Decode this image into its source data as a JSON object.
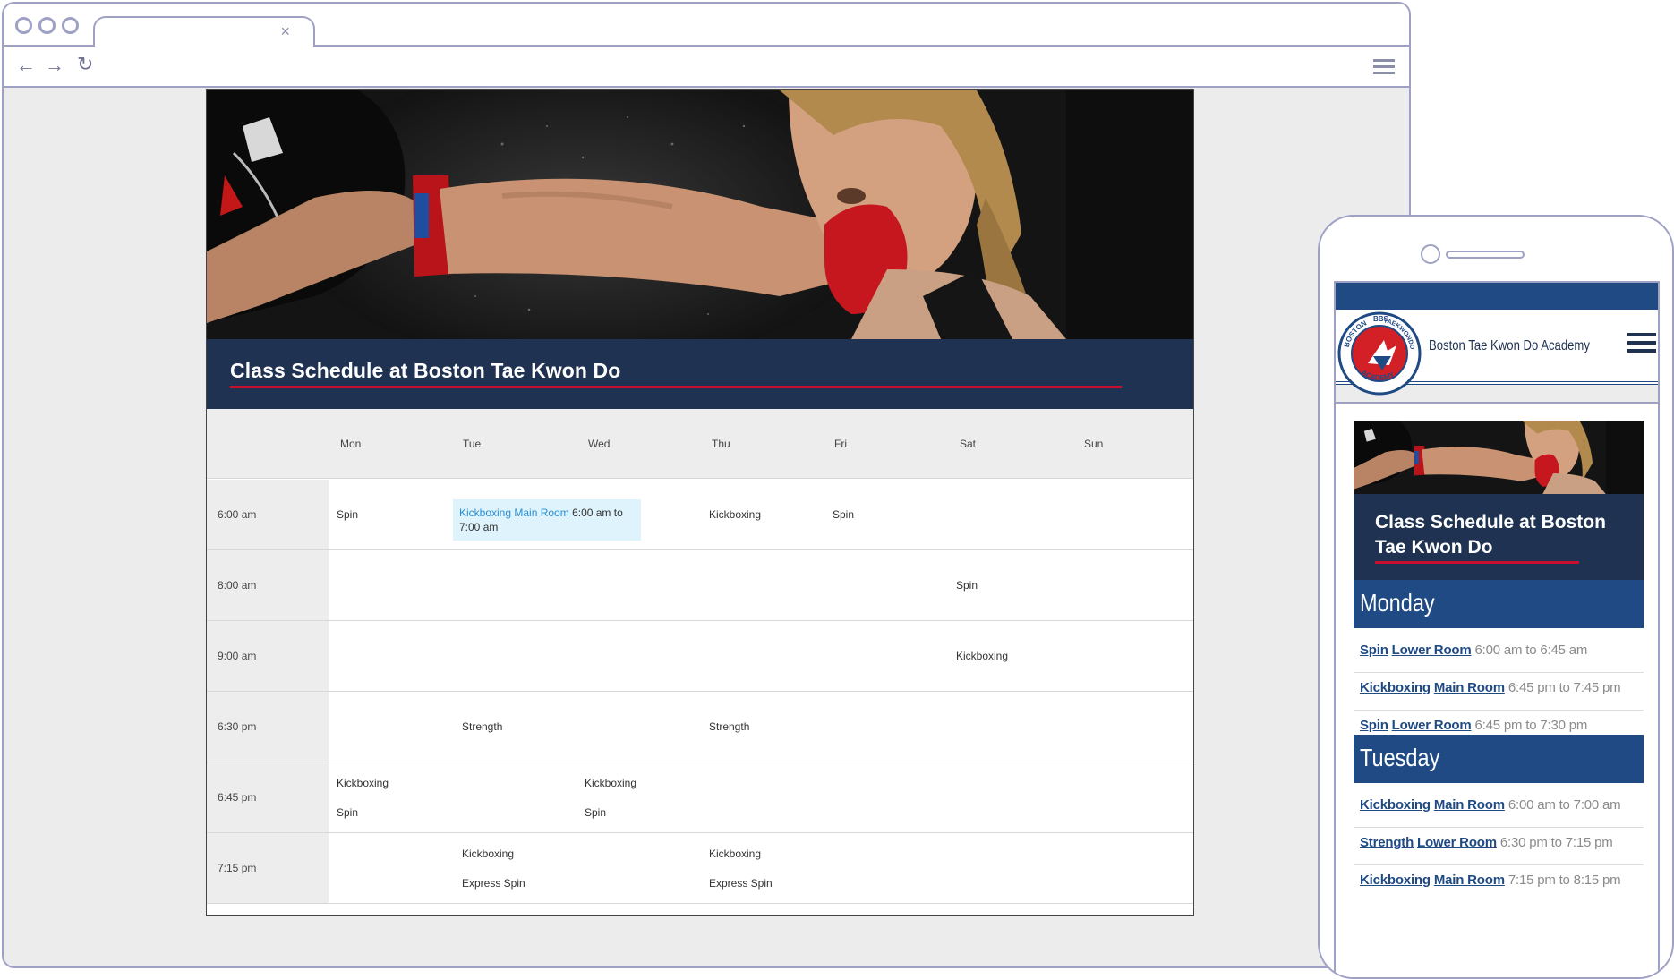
{
  "browser": {
    "tab_close": "×",
    "nav": {
      "back": "←",
      "forward": "→",
      "reload": "↻"
    }
  },
  "desktop": {
    "title": "Class Schedule at Boston Tae Kwon Do",
    "days": [
      "Mon",
      "Tue",
      "Wed",
      "Thu",
      "Fri",
      "Sat",
      "Sun"
    ],
    "rows": [
      {
        "time": "6:00 am",
        "entries": [
          {
            "day": "Mon",
            "lines": [
              "Spin"
            ]
          },
          {
            "day": "Tue",
            "highlight": true,
            "link": "Kickboxing Main Room",
            "rest": "6:00 am to 7:00 am"
          },
          {
            "day": "Thu",
            "lines": [
              "Kickboxing"
            ]
          },
          {
            "day": "Fri",
            "lines": [
              "Spin"
            ]
          }
        ]
      },
      {
        "time": "8:00 am",
        "entries": [
          {
            "day": "Sat",
            "lines": [
              "Spin"
            ]
          }
        ]
      },
      {
        "time": "9:00 am",
        "entries": [
          {
            "day": "Sat",
            "lines": [
              "Kickboxing"
            ]
          }
        ]
      },
      {
        "time": "6:30 pm",
        "entries": [
          {
            "day": "Tue",
            "lines": [
              "Strength"
            ]
          },
          {
            "day": "Thu",
            "lines": [
              "Strength"
            ]
          }
        ]
      },
      {
        "time": "6:45 pm",
        "entries": [
          {
            "day": "Mon",
            "lines": [
              "Kickboxing",
              "Spin"
            ]
          },
          {
            "day": "Wed",
            "lines": [
              "Kickboxing",
              "Spin"
            ]
          }
        ]
      },
      {
        "time": "7:15 pm",
        "entries": [
          {
            "day": "Tue",
            "lines": [
              "Kickboxing",
              "Express Spin"
            ]
          },
          {
            "day": "Thu",
            "lines": [
              "Kickboxing",
              "Express Spin"
            ]
          }
        ]
      }
    ]
  },
  "mobile": {
    "brand": "Boston Tae Kwon Do Academy",
    "logo_text": {
      "top": "BOSTON",
      "right": "TAEKWONDO",
      "bottom": "ACADEMY",
      "left": "BBS"
    },
    "title": "Class Schedule at Boston Tae Kwon Do",
    "schedule": [
      {
        "day": "Monday",
        "items": [
          {
            "class": "Spin",
            "room": "Lower Room",
            "time": "6:00 am to 6:45 am"
          },
          {
            "class": "Kickboxing",
            "room": "Main Room",
            "time": "6:45 pm to 7:45 pm"
          },
          {
            "class": "Spin",
            "room": "Lower Room",
            "time": "6:45 pm to 7:30 pm"
          }
        ]
      },
      {
        "day": "Tuesday",
        "items": [
          {
            "class": "Kickboxing",
            "room": "Main Room",
            "time": "6:00 am to 7:00 am"
          },
          {
            "class": "Strength",
            "room": "Lower Room",
            "time": "6:30 pm to 7:15 pm"
          },
          {
            "class": "Kickboxing",
            "room": "Main Room",
            "time": "7:15 pm to 8:15 pm"
          }
        ]
      }
    ]
  },
  "colors": {
    "navy": "#1f3252",
    "blue": "#1f4a84",
    "red": "#c8102e",
    "link": "#2a8fd0",
    "highlight": "#def3fb",
    "frame": "#9ea1c3"
  }
}
